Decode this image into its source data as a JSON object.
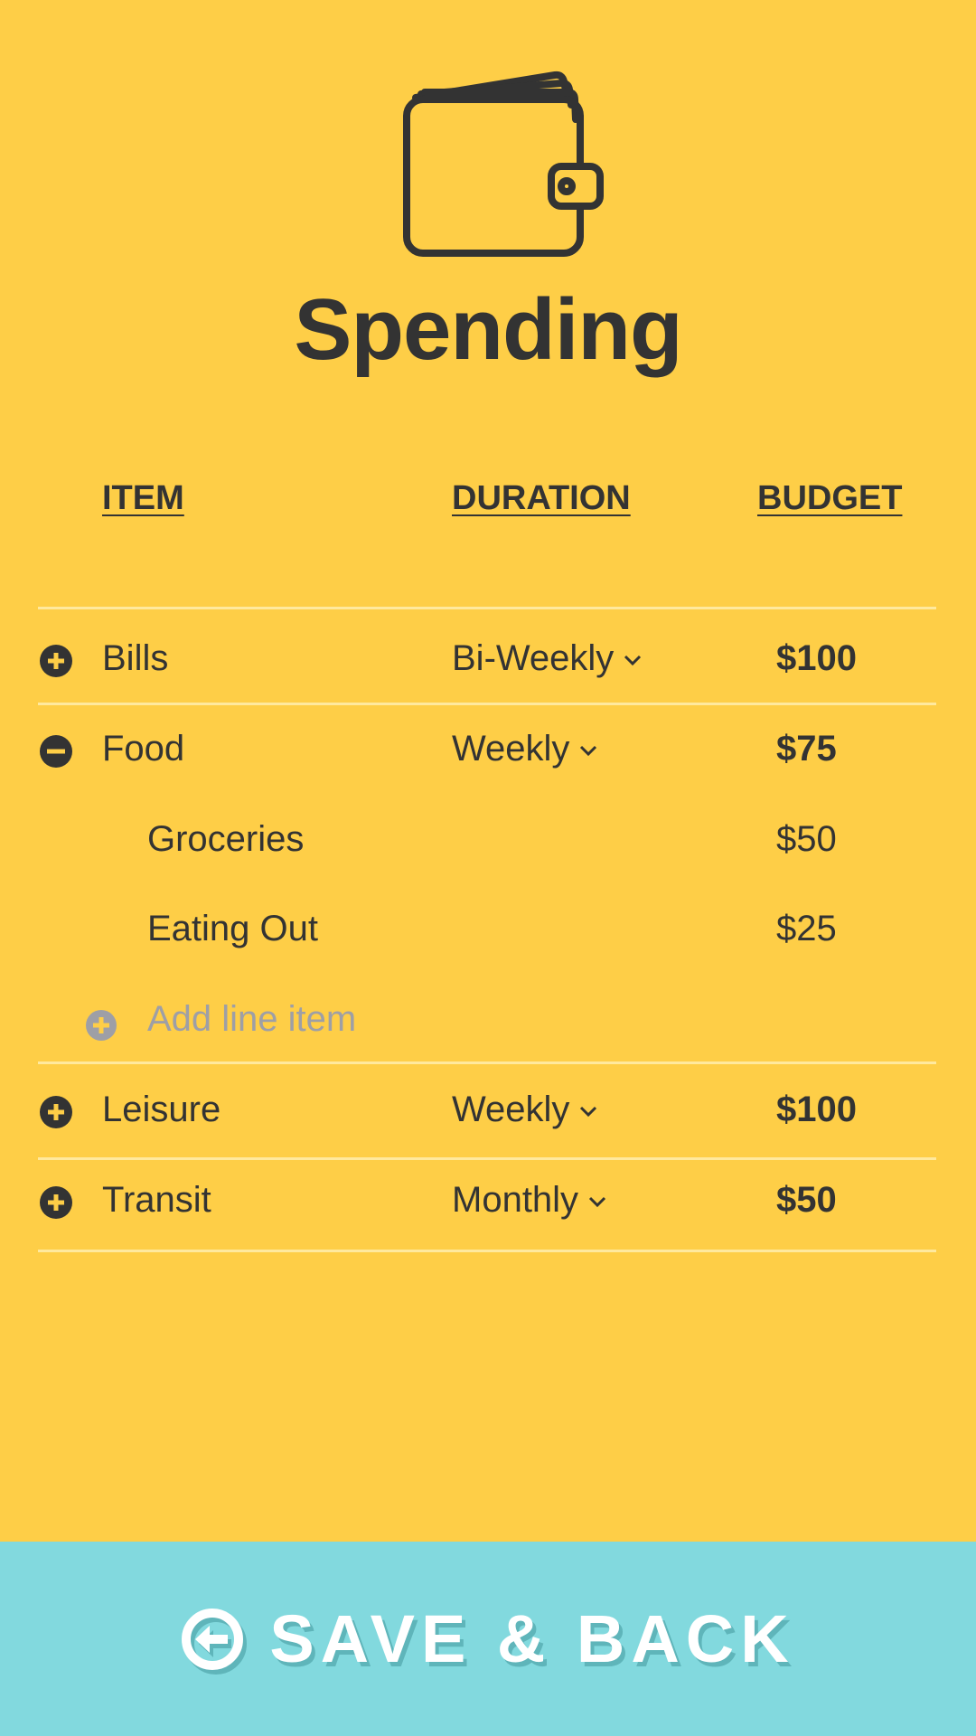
{
  "colors": {
    "background": "#FECE47",
    "text": "#333333",
    "divider": "#FFE99E",
    "muted": "#9E9FA6",
    "save_bar": "#82D9DE",
    "save_text": "#FFFFFF"
  },
  "header": {
    "icon": "wallet-icon",
    "title": "Spending"
  },
  "columns": {
    "item": "ITEM",
    "duration": "DURATION",
    "budget": "BUDGET"
  },
  "rows": [
    {
      "icon": "plus-circle-icon",
      "name": "Bills",
      "duration": "Bi-Weekly",
      "budget": "$100",
      "expanded": false
    },
    {
      "icon": "minus-circle-icon",
      "name": "Food",
      "duration": "Weekly",
      "budget": "$75",
      "expanded": true,
      "subitems": [
        {
          "name": "Groceries",
          "budget": "$50"
        },
        {
          "name": "Eating Out",
          "budget": "$25"
        }
      ],
      "add_line_label": "Add line item"
    },
    {
      "icon": "plus-circle-icon",
      "name": "Leisure",
      "duration": "Weekly",
      "budget": "$100",
      "expanded": false
    },
    {
      "icon": "plus-circle-icon",
      "name": "Transit",
      "duration": "Monthly",
      "budget": "$50",
      "expanded": false
    }
  ],
  "footer": {
    "icon": "back-arrow-circle-icon",
    "save_label": "SAVE & BACK"
  }
}
